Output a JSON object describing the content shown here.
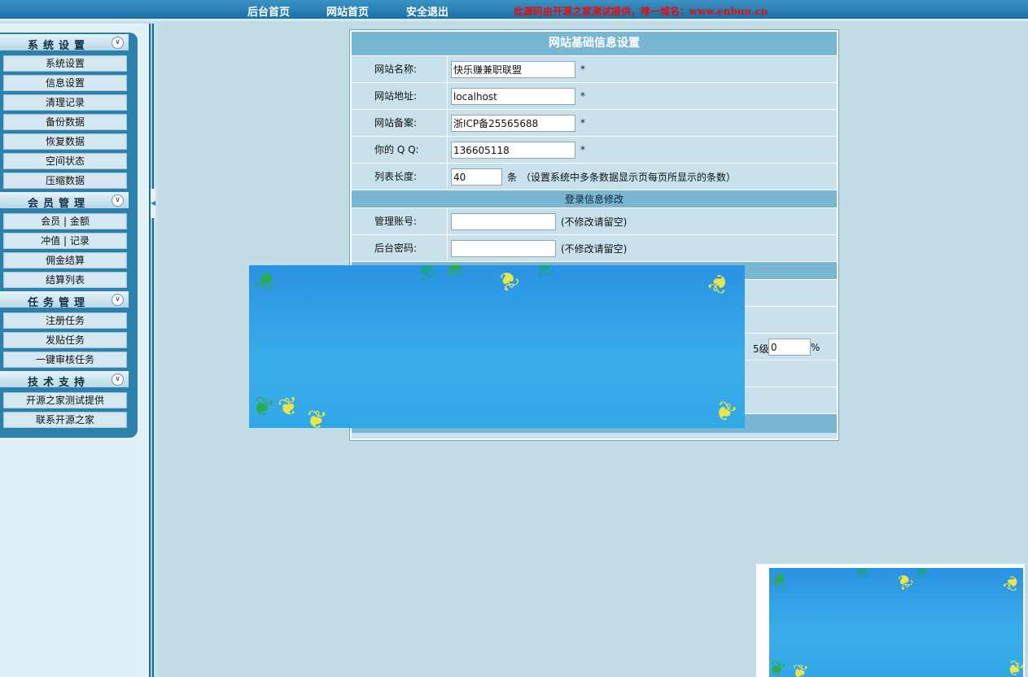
{
  "topnav": {
    "admin_home": "后台首页",
    "site_home": "网站首页",
    "logout": "安全退出",
    "notice": "此源码由开源之家测试提供，唯一域名：www.enbuu.cn"
  },
  "sidebar": {
    "groups": [
      {
        "title": "系统设置",
        "items": [
          "系统设置",
          "信息设置",
          "清理记录",
          "备份数据",
          "恢复数据",
          "空间状态",
          "压缩数据"
        ]
      },
      {
        "title": "会员管理",
        "items": [
          "会员 | 金额",
          "冲值 | 记录",
          "佣金结算",
          "结算列表"
        ]
      },
      {
        "title": "任务管理",
        "items": [
          "注册任务",
          "发贴任务",
          "一键审核任务"
        ]
      },
      {
        "title": "技术支持",
        "items": [
          "开源之家测试提供",
          "联系开源之家"
        ]
      }
    ]
  },
  "panel": {
    "title": "网站基础信息设置",
    "site_name": {
      "label": "网站名称:",
      "value": "快乐赚兼职联盟"
    },
    "site_url": {
      "label": "网站地址:",
      "value": "localhost"
    },
    "icp": {
      "label": "网站备案:",
      "value": "浙ICP备25565688"
    },
    "qq": {
      "label": "你的 Q Q:",
      "value": "136605118"
    },
    "list_length": {
      "label": "列表长度:",
      "value": "40",
      "unit": "条",
      "hint": "（设置系统中多条数据显示页每页所显示的条数）"
    },
    "required_mark": "*",
    "login_section": "登录信息修改",
    "admin_account": {
      "label": "管理账号:",
      "value": "",
      "hint": "(不修改请留空)"
    },
    "admin_password": {
      "label": "后台密码:",
      "value": "",
      "hint": "(不修改请留空)"
    },
    "level5": {
      "label": "5级",
      "value": "0",
      "unit": "%"
    }
  },
  "colors": {
    "topbar": "#2a82b8",
    "sidebar_frame": "#2d7fae",
    "panel_header": "#78b6d2",
    "background": "#c2dde8",
    "notice": "#e30d0d",
    "overlay_blue": "#2a9ae6"
  }
}
